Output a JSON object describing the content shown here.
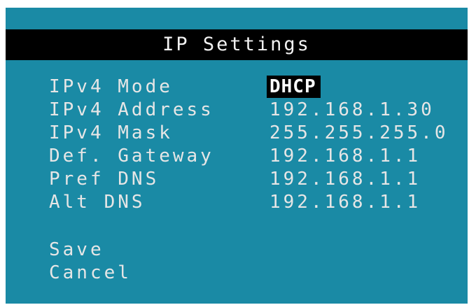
{
  "title": "IP Settings",
  "fields": [
    {
      "label": "IPv4 Mode",
      "value": "DHCP"
    },
    {
      "label": "IPv4 Address",
      "value": "192.168.1.30"
    },
    {
      "label": "IPv4 Mask",
      "value": "255.255.255.0"
    },
    {
      "label": "Def. Gateway",
      "value": "192.168.1.1"
    },
    {
      "label": "Pref DNS",
      "value": "192.168.1.1"
    },
    {
      "label": "Alt DNS",
      "value": "192.168.1.1"
    }
  ],
  "actions": {
    "save_label": "Save",
    "cancel_label": "Cancel"
  },
  "colors": {
    "screen_background": "#1a8aa5",
    "title_bar_background": "#000000",
    "text": "#e6e6e6",
    "selected_background": "#000000"
  }
}
